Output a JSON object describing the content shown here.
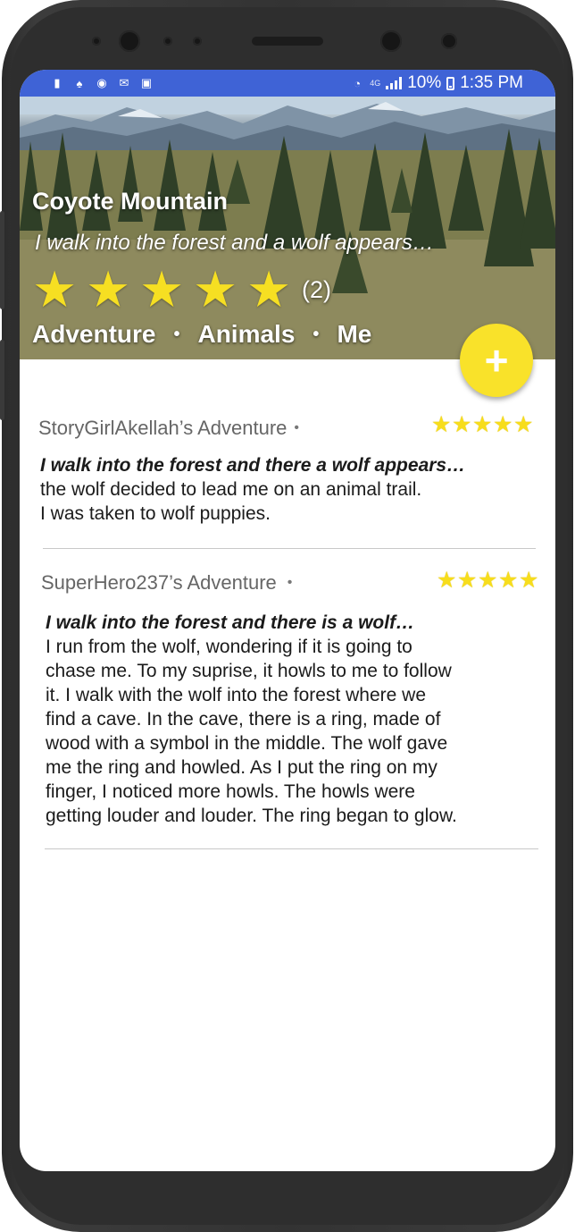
{
  "status_bar": {
    "icons": [
      "alert-icon",
      "snapchat-icon",
      "messenger-icon",
      "gmail-icon",
      "instagram-icon"
    ],
    "network": "4G",
    "battery": "10%",
    "time": "1:35 PM"
  },
  "story": {
    "title": "Coyote Mountain",
    "subtitle": "I walk into the forest and a wolf appears…",
    "rating_stars": 5,
    "rating_count": "(2)",
    "tags": [
      "Adventure",
      "Animals",
      "Me"
    ],
    "tag_separator": "•"
  },
  "fab": {
    "label": "+"
  },
  "reviews": [
    {
      "author": "StoryGirlAkellah’s Adventure",
      "dot": "•",
      "stars": 5,
      "lead": "I walk into the forest and there a wolf appears…",
      "lines": [
        "the wolf decided to lead me on an animal trail.",
        "I was taken to wolf puppies."
      ]
    },
    {
      "author": "SuperHero237’s Adventure",
      "dot": "•",
      "stars": 5,
      "lead": "I walk into the forest and there is a wolf…",
      "lines": [
        "I run from the wolf, wondering if it is going to",
        "chase me.  To my suprise, it howls to me to follow",
        "it.  I walk with the wolf into the forest where we",
        "find a cave.  In the cave, there is a ring, made of",
        "wood with a symbol in the middle.  The wolf gave",
        "me the ring and howled.  As I put the ring on my",
        "finger, I noticed more howls.  The howls were",
        "getting louder and louder.  The ring began to glow."
      ]
    }
  ],
  "colors": {
    "status_bar": "#3f63d6",
    "star": "#f6df22",
    "fab": "#f9e22a"
  }
}
